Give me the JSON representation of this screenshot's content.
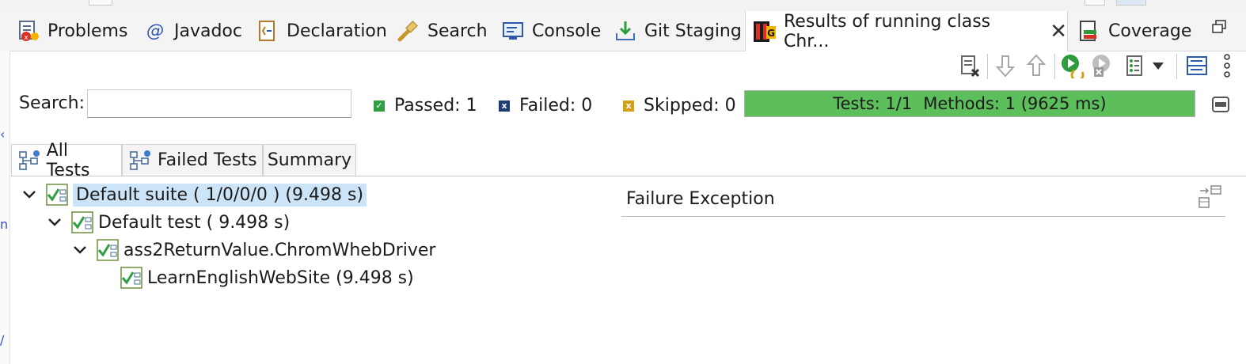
{
  "view_tabs": [
    {
      "label": "Problems",
      "icon": "problems-icon"
    },
    {
      "label": "Javadoc",
      "icon": "javadoc-at-icon"
    },
    {
      "label": "Declaration",
      "icon": "declaration-icon"
    },
    {
      "label": "Search",
      "icon": "search-flashlight-icon"
    },
    {
      "label": "Console",
      "icon": "console-icon"
    },
    {
      "label": "Git Staging",
      "icon": "git-staging-icon"
    },
    {
      "label": "Results of running class Chr...",
      "icon": "testng-icon",
      "active": true
    },
    {
      "label": "Coverage",
      "icon": "coverage-icon"
    }
  ],
  "search": {
    "label": "Search:",
    "value": "",
    "placeholder": ""
  },
  "counters": {
    "passed": "Passed: 1",
    "failed": "Failed: 0",
    "skipped": "Skipped: 0"
  },
  "progress": {
    "tests": "Tests: 1/1",
    "methods": "Methods: 1 (9625 ms)",
    "fraction": 1.0,
    "color": "#5cbf5c"
  },
  "inner_tabs": [
    {
      "label": "All Tests",
      "active": true
    },
    {
      "label": "Failed Tests"
    },
    {
      "label": "Summary"
    }
  ],
  "tree": [
    {
      "label": "Default suite ( 1/0/0/0 ) (9.498 s)",
      "selected": true
    },
    {
      "label": "Default test ( 9.498 s)"
    },
    {
      "label": "ass2ReturnValue.ChromWhebDriver"
    },
    {
      "label": "LearnEnglishWebSite  (9.498 s)"
    }
  ],
  "failure_exception": {
    "title": "Failure Exception"
  },
  "colors": {
    "passed": "#2ea043",
    "failed": "#1f3b73",
    "skipped": "#d4a017",
    "selection": "#cce4f7"
  }
}
